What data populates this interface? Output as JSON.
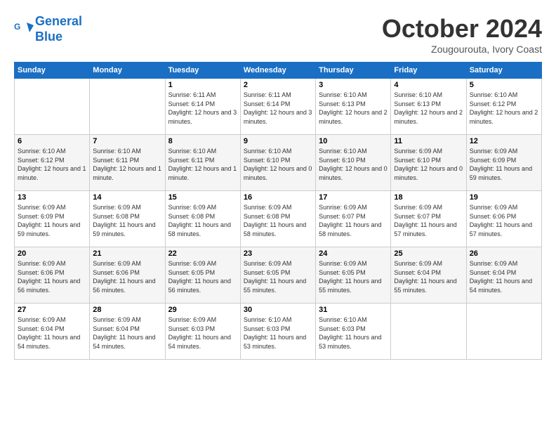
{
  "header": {
    "logo_line1": "General",
    "logo_line2": "Blue",
    "month": "October 2024",
    "location": "Zougourouta, Ivory Coast"
  },
  "weekdays": [
    "Sunday",
    "Monday",
    "Tuesday",
    "Wednesday",
    "Thursday",
    "Friday",
    "Saturday"
  ],
  "weeks": [
    [
      {
        "day": "",
        "sunrise": "",
        "sunset": "",
        "daylight": ""
      },
      {
        "day": "",
        "sunrise": "",
        "sunset": "",
        "daylight": ""
      },
      {
        "day": "1",
        "sunrise": "Sunrise: 6:11 AM",
        "sunset": "Sunset: 6:14 PM",
        "daylight": "Daylight: 12 hours and 3 minutes."
      },
      {
        "day": "2",
        "sunrise": "Sunrise: 6:11 AM",
        "sunset": "Sunset: 6:14 PM",
        "daylight": "Daylight: 12 hours and 3 minutes."
      },
      {
        "day": "3",
        "sunrise": "Sunrise: 6:10 AM",
        "sunset": "Sunset: 6:13 PM",
        "daylight": "Daylight: 12 hours and 2 minutes."
      },
      {
        "day": "4",
        "sunrise": "Sunrise: 6:10 AM",
        "sunset": "Sunset: 6:13 PM",
        "daylight": "Daylight: 12 hours and 2 minutes."
      },
      {
        "day": "5",
        "sunrise": "Sunrise: 6:10 AM",
        "sunset": "Sunset: 6:12 PM",
        "daylight": "Daylight: 12 hours and 2 minutes."
      }
    ],
    [
      {
        "day": "6",
        "sunrise": "Sunrise: 6:10 AM",
        "sunset": "Sunset: 6:12 PM",
        "daylight": "Daylight: 12 hours and 1 minute."
      },
      {
        "day": "7",
        "sunrise": "Sunrise: 6:10 AM",
        "sunset": "Sunset: 6:11 PM",
        "daylight": "Daylight: 12 hours and 1 minute."
      },
      {
        "day": "8",
        "sunrise": "Sunrise: 6:10 AM",
        "sunset": "Sunset: 6:11 PM",
        "daylight": "Daylight: 12 hours and 1 minute."
      },
      {
        "day": "9",
        "sunrise": "Sunrise: 6:10 AM",
        "sunset": "Sunset: 6:10 PM",
        "daylight": "Daylight: 12 hours and 0 minutes."
      },
      {
        "day": "10",
        "sunrise": "Sunrise: 6:10 AM",
        "sunset": "Sunset: 6:10 PM",
        "daylight": "Daylight: 12 hours and 0 minutes."
      },
      {
        "day": "11",
        "sunrise": "Sunrise: 6:09 AM",
        "sunset": "Sunset: 6:10 PM",
        "daylight": "Daylight: 12 hours and 0 minutes."
      },
      {
        "day": "12",
        "sunrise": "Sunrise: 6:09 AM",
        "sunset": "Sunset: 6:09 PM",
        "daylight": "Daylight: 11 hours and 59 minutes."
      }
    ],
    [
      {
        "day": "13",
        "sunrise": "Sunrise: 6:09 AM",
        "sunset": "Sunset: 6:09 PM",
        "daylight": "Daylight: 11 hours and 59 minutes."
      },
      {
        "day": "14",
        "sunrise": "Sunrise: 6:09 AM",
        "sunset": "Sunset: 6:08 PM",
        "daylight": "Daylight: 11 hours and 59 minutes."
      },
      {
        "day": "15",
        "sunrise": "Sunrise: 6:09 AM",
        "sunset": "Sunset: 6:08 PM",
        "daylight": "Daylight: 11 hours and 58 minutes."
      },
      {
        "day": "16",
        "sunrise": "Sunrise: 6:09 AM",
        "sunset": "Sunset: 6:08 PM",
        "daylight": "Daylight: 11 hours and 58 minutes."
      },
      {
        "day": "17",
        "sunrise": "Sunrise: 6:09 AM",
        "sunset": "Sunset: 6:07 PM",
        "daylight": "Daylight: 11 hours and 58 minutes."
      },
      {
        "day": "18",
        "sunrise": "Sunrise: 6:09 AM",
        "sunset": "Sunset: 6:07 PM",
        "daylight": "Daylight: 11 hours and 57 minutes."
      },
      {
        "day": "19",
        "sunrise": "Sunrise: 6:09 AM",
        "sunset": "Sunset: 6:06 PM",
        "daylight": "Daylight: 11 hours and 57 minutes."
      }
    ],
    [
      {
        "day": "20",
        "sunrise": "Sunrise: 6:09 AM",
        "sunset": "Sunset: 6:06 PM",
        "daylight": "Daylight: 11 hours and 56 minutes."
      },
      {
        "day": "21",
        "sunrise": "Sunrise: 6:09 AM",
        "sunset": "Sunset: 6:06 PM",
        "daylight": "Daylight: 11 hours and 56 minutes."
      },
      {
        "day": "22",
        "sunrise": "Sunrise: 6:09 AM",
        "sunset": "Sunset: 6:05 PM",
        "daylight": "Daylight: 11 hours and 56 minutes."
      },
      {
        "day": "23",
        "sunrise": "Sunrise: 6:09 AM",
        "sunset": "Sunset: 6:05 PM",
        "daylight": "Daylight: 11 hours and 55 minutes."
      },
      {
        "day": "24",
        "sunrise": "Sunrise: 6:09 AM",
        "sunset": "Sunset: 6:05 PM",
        "daylight": "Daylight: 11 hours and 55 minutes."
      },
      {
        "day": "25",
        "sunrise": "Sunrise: 6:09 AM",
        "sunset": "Sunset: 6:04 PM",
        "daylight": "Daylight: 11 hours and 55 minutes."
      },
      {
        "day": "26",
        "sunrise": "Sunrise: 6:09 AM",
        "sunset": "Sunset: 6:04 PM",
        "daylight": "Daylight: 11 hours and 54 minutes."
      }
    ],
    [
      {
        "day": "27",
        "sunrise": "Sunrise: 6:09 AM",
        "sunset": "Sunset: 6:04 PM",
        "daylight": "Daylight: 11 hours and 54 minutes."
      },
      {
        "day": "28",
        "sunrise": "Sunrise: 6:09 AM",
        "sunset": "Sunset: 6:04 PM",
        "daylight": "Daylight: 11 hours and 54 minutes."
      },
      {
        "day": "29",
        "sunrise": "Sunrise: 6:09 AM",
        "sunset": "Sunset: 6:03 PM",
        "daylight": "Daylight: 11 hours and 54 minutes."
      },
      {
        "day": "30",
        "sunrise": "Sunrise: 6:10 AM",
        "sunset": "Sunset: 6:03 PM",
        "daylight": "Daylight: 11 hours and 53 minutes."
      },
      {
        "day": "31",
        "sunrise": "Sunrise: 6:10 AM",
        "sunset": "Sunset: 6:03 PM",
        "daylight": "Daylight: 11 hours and 53 minutes."
      },
      {
        "day": "",
        "sunrise": "",
        "sunset": "",
        "daylight": ""
      },
      {
        "day": "",
        "sunrise": "",
        "sunset": "",
        "daylight": ""
      }
    ]
  ]
}
